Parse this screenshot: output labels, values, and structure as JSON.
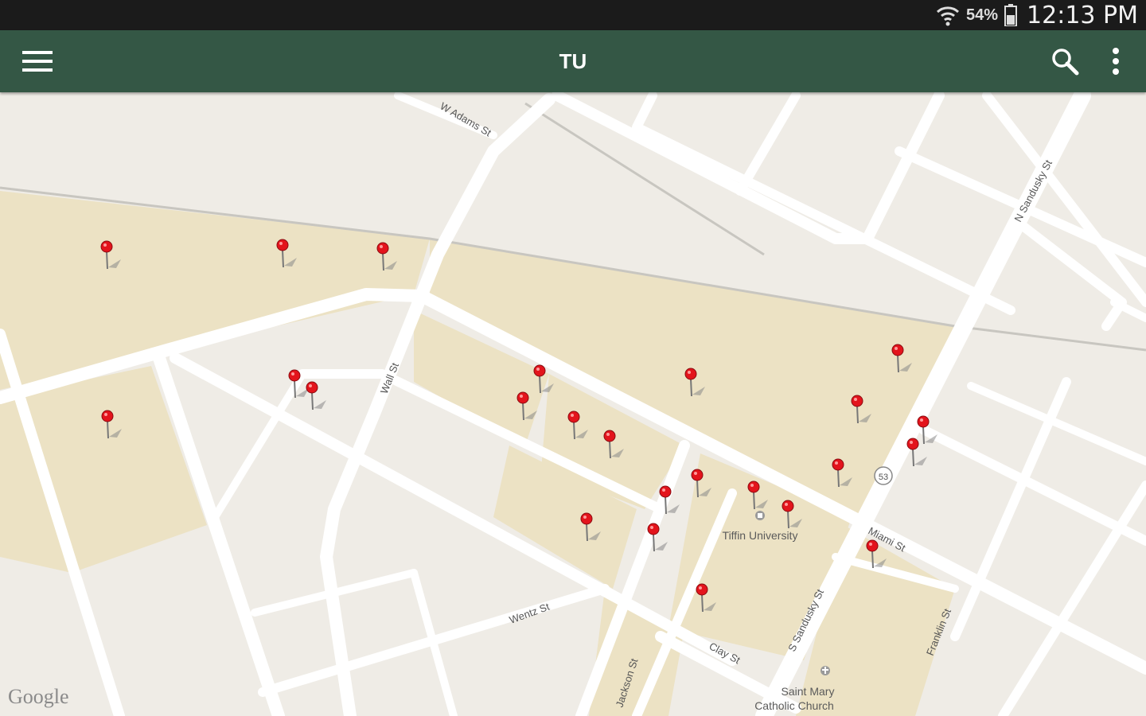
{
  "status_bar": {
    "battery": "54%",
    "time": "12:13 PM",
    "icons": [
      "wifi-icon",
      "battery-icon"
    ]
  },
  "toolbar": {
    "title": "TU",
    "menu_icon": "hamburger-menu-icon",
    "search_icon": "search-icon",
    "more_icon": "overflow-menu-icon"
  },
  "map": {
    "colors": {
      "land": "#efece6",
      "campus": "#ece2c4",
      "road": "#ffffff",
      "rail": "#c8c6c0",
      "toolbar": "#345745",
      "pin": "#e3141c"
    },
    "streets": [
      {
        "name": "W Adams St"
      },
      {
        "name": "N Sandusky St"
      },
      {
        "name": "Wall St"
      },
      {
        "name": "Miami St"
      },
      {
        "name": "S Sandusky St"
      },
      {
        "name": "Wentz St"
      },
      {
        "name": "Clay St"
      },
      {
        "name": "Jackson St"
      },
      {
        "name": "Franklin St"
      },
      {
        "name": "53"
      }
    ],
    "pois": [
      {
        "name": "Tiffin University"
      },
      {
        "name_line1": "Saint Mary",
        "name_line2": "Catholic Church"
      }
    ],
    "attribution": "Google",
    "marker_count": 24
  }
}
